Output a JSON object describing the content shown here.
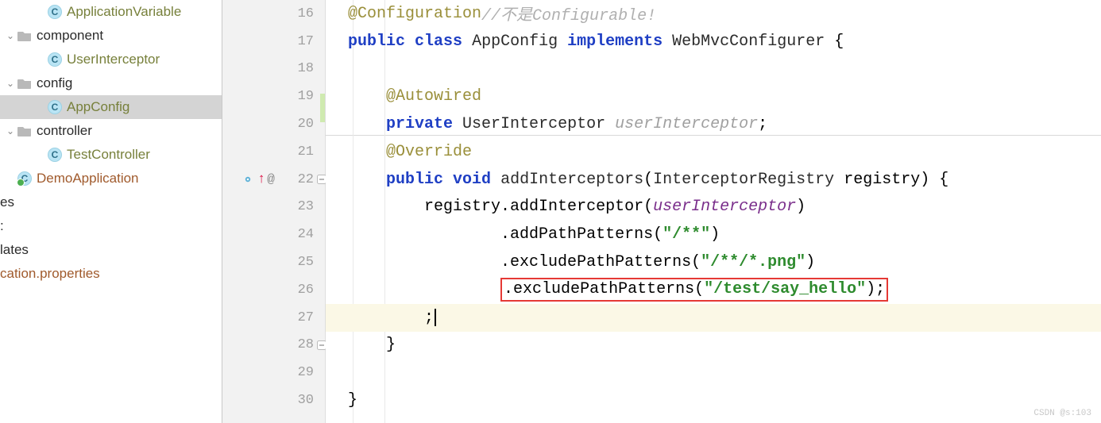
{
  "tree": {
    "items": [
      {
        "icon": "class",
        "indent": "indent2",
        "label": "ApplicationVariable",
        "cls": "olive",
        "chevron": ""
      },
      {
        "icon": "folder-gray",
        "indent": "indent1",
        "label": "component",
        "cls": "dark",
        "chevron": "⌄"
      },
      {
        "icon": "class",
        "indent": "indent2",
        "label": "UserInterceptor",
        "cls": "olive",
        "chevron": ""
      },
      {
        "icon": "folder-gray",
        "indent": "indent1",
        "label": "config",
        "cls": "dark",
        "chevron": "⌄"
      },
      {
        "icon": "class",
        "indent": "indent2",
        "label": "AppConfig",
        "cls": "olive selected",
        "chevron": ""
      },
      {
        "icon": "folder-gray",
        "indent": "indent1",
        "label": "controller",
        "cls": "dark",
        "chevron": "⌄"
      },
      {
        "icon": "class",
        "indent": "indent2",
        "label": "TestController",
        "cls": "olive",
        "chevron": ""
      },
      {
        "icon": "class-green",
        "indent": "indent1",
        "label": "DemoApplication",
        "cls": "brown",
        "chevron": ""
      }
    ],
    "cutItems": [
      {
        "label": "es"
      },
      {
        "label": ":"
      },
      {
        "label": "lates"
      },
      {
        "label": "cation.properties",
        "brown": true
      }
    ]
  },
  "gutter": {
    "lines": [
      "16",
      "17",
      "18",
      "19",
      "20",
      "21",
      "22",
      "23",
      "24",
      "25",
      "26",
      "27",
      "28",
      "29",
      "30"
    ],
    "override_at": 6,
    "fold_open": 6,
    "fold_close": 12,
    "override_arrow": "↑",
    "override_at_symbol": "@"
  },
  "code": {
    "ann_configuration": "@Configuration",
    "comment_notconfigurable": "//不是Configurable!",
    "kw_public": "public",
    "kw_class": "class",
    "cls_appconfig": "AppConfig",
    "kw_implements": "implements",
    "cls_webmvc": "WebMvcConfigurer",
    "brace_open": "{",
    "ann_autowired": "@Autowired",
    "kw_private": "private",
    "cls_userinterceptor": "UserInterceptor",
    "field_userinterceptor": "userInterceptor",
    "semi": ";",
    "ann_override": "@Override",
    "kw_void": "void",
    "method_addinterceptors": "addInterceptors",
    "paren_open": "(",
    "cls_registry": "InterceptorRegistry",
    "param_registry": "registry",
    "paren_close": ")",
    "line23": "registry.addInterceptor(",
    "id_userInterceptor": "userInterceptor",
    "line23_end": ")",
    "line24_method": ".addPathPatterns(",
    "str24": "\"/**\"",
    "line24_end": ")",
    "line25_method": ".excludePathPatterns(",
    "str25": "\"/**/*.png\"",
    "line25_end": ")",
    "line26_method": ".excludePathPatterns(",
    "str26": "\"/test/say_hello\"",
    "line26_end": ");",
    "line27_semi": ";",
    "brace_close_inner": "}",
    "brace_close_outer": "}"
  },
  "watermark": "CSDN @s:103"
}
